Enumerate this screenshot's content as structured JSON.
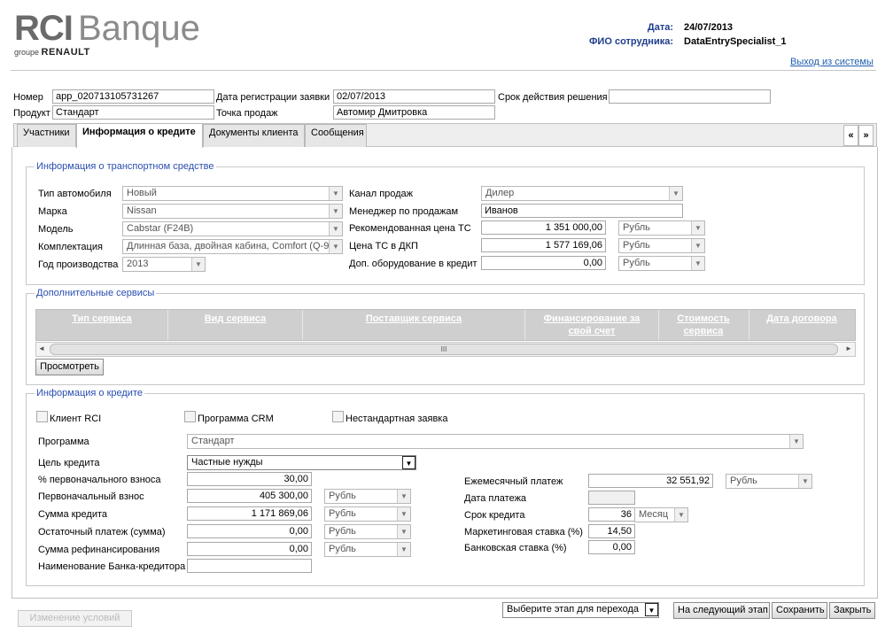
{
  "brand": {
    "name_rci": "RCI",
    "name_banque": "Banque",
    "group_prefix": "groupe",
    "group_name": "RENAULT"
  },
  "header": {
    "date_label": "Дата:",
    "date_value": "24/07/2013",
    "employee_label": "ФИО сотрудника:",
    "employee_value": "DataEntrySpecialist_1",
    "logout": "Выход из системы"
  },
  "app": {
    "number_label": "Номер",
    "number_value": "app_020713105731267",
    "reg_date_label": "Дата регистрации заявки",
    "reg_date_value": "02/07/2013",
    "decision_label": "Срок действия решения",
    "decision_value": "",
    "product_label": "Продукт",
    "product_value": "Стандарт",
    "point_label": "Точка продаж",
    "point_value": "Автомир Дмитровка"
  },
  "tabs": [
    "Участники",
    "Информация о кредите",
    "Документы клиента",
    "Сообщения"
  ],
  "nav": {
    "prev": "«",
    "next": "»"
  },
  "vehicle": {
    "legend": "Информация о транспортном средстве",
    "type_label": "Тип автомобиля",
    "type_value": "Новый",
    "brand_label": "Марка",
    "brand_value": "Nissan",
    "model_label": "Модель",
    "model_value": "Cabstar (F24B)",
    "equip_label": "Комплектация",
    "equip_value": "Длинная база, двойная кабина, Comfort (Q-9",
    "year_label": "Год производства",
    "year_value": "2013",
    "channel_label": "Канал продаж",
    "channel_value": "Дилер",
    "manager_label": "Менеджер по продажам",
    "manager_value": "Иванов",
    "rec_price_label": "Рекомендованная цена ТС",
    "rec_price_value": "1 351 000,00",
    "rec_price_cur": "Рубль",
    "dkp_price_label": "Цена ТС в ДКП",
    "dkp_price_value": "1 577 169,06",
    "dkp_price_cur": "Рубль",
    "addeq_label": "Доп. оборудование в кредит",
    "addeq_value": "0,00",
    "addeq_cur": "Рубль"
  },
  "services": {
    "legend": "Дополнительные сервисы",
    "columns": [
      "Тип сервиса",
      "Вид сервиса",
      "Поставщик сервиса",
      "Финансирование за свой счет",
      "Стоимость сервиса",
      "Дата договора"
    ],
    "view_button": "Просмотреть",
    "scroll_grip": "III"
  },
  "credit": {
    "legend": "Информация о кредите",
    "client_rci": "Клиент RCI",
    "crm_program": "Программа CRM",
    "nonstandard": "Нестандартная заявка",
    "program_label": "Программа",
    "program_value": "Стандарт",
    "purpose_label": "Цель кредита",
    "purpose_value": "Частные нужды",
    "down_pct_label": "% первоначального взноса",
    "down_pct_value": "30,00",
    "down_label": "Первоначальный взнос",
    "down_value": "405 300,00",
    "down_cur": "Рубль",
    "sum_label": "Сумма кредита",
    "sum_value": "1 171 869,06",
    "sum_cur": "Рубль",
    "residual_label": "Остаточный платеж (сумма)",
    "residual_value": "0,00",
    "residual_cur": "Рубль",
    "refin_label": "Сумма рефинансирования",
    "refin_value": "0,00",
    "refin_cur": "Рубль",
    "bank_label": "Наименование Банка-кредитора",
    "bank_value": "",
    "monthly_label": "Ежемесячный платеж",
    "monthly_value": "32 551,92",
    "monthly_cur": "Рубль",
    "paydate_label": "Дата платежа",
    "paydate_value": "",
    "term_label": "Срок кредита",
    "term_value": "36",
    "term_unit": "Месяц",
    "mkt_rate_label": "Маркетинговая ставка (%)",
    "mkt_rate_value": "14,50",
    "bank_rate_label": "Банковская ставка (%)",
    "bank_rate_value": "0,00"
  },
  "footer": {
    "change_terms": "Изменение условий",
    "stage_select": "Выберите этап для перехода",
    "next_stage": "На следующий этап",
    "save": "Сохранить",
    "close": "Закрыть"
  },
  "colors": {
    "label_blue": "#1f3d8c",
    "legend_blue": "#2a4eb0",
    "grid_header": "#cfcfcf"
  }
}
